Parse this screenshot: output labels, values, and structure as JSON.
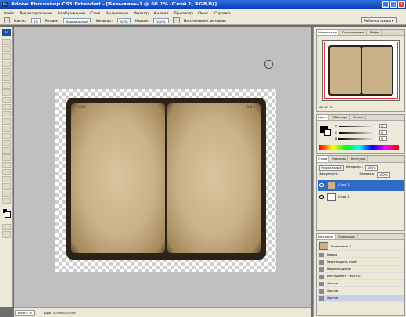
{
  "app": {
    "title": "Adobe Photoshop CS3 Extended - [Безымянн-1 @ 66.7% (Слой 2, RGB/8)]",
    "icon_label": "Ps"
  },
  "window_buttons": {
    "minimize": "_",
    "maximize": "□",
    "close": "×"
  },
  "menu": [
    "Файл",
    "Редактирование",
    "Изображение",
    "Слой",
    "Выделение",
    "Фильтр",
    "Анализ",
    "Просмотр",
    "Окно",
    "Справка"
  ],
  "options": {
    "brush_label": "Кисть:",
    "brush_size": "13",
    "mode_label": "Режим:",
    "mode_value": "Нормальный",
    "opacity_label": "Непрозр.:",
    "opacity_value": "67%",
    "flow_label": "Нажим:",
    "flow_value": "100%",
    "history_checkbox": "Восстановить историю",
    "workspace": "Рабочая среда ▾"
  },
  "document": {
    "page_num_left": "183",
    "page_num_right": "184"
  },
  "status": {
    "zoom": "66.67 %",
    "doc_info": "Док: 3,09M/2,07M"
  },
  "navigator": {
    "tabs": [
      "Навигатор",
      "Гистограмма",
      "Инфо"
    ],
    "zoom": "66.67 %"
  },
  "color_panel": {
    "tabs": [
      "Цвет",
      "Образцы",
      "Стили"
    ],
    "channels": [
      {
        "label": "R",
        "value": "0"
      },
      {
        "label": "G",
        "value": "0"
      },
      {
        "label": "B",
        "value": "0"
      }
    ]
  },
  "layers_panel": {
    "tabs": [
      "Слои",
      "Каналы",
      "Контуры"
    ],
    "blend_mode": "Нормальный",
    "opacity_label": "Непрозр.:",
    "opacity_value": "100%",
    "lock_label": "Закрепить:",
    "fill_label": "Заливка:",
    "fill_value": "100%",
    "layers": [
      {
        "name": "Слой 2",
        "selected": true
      },
      {
        "name": "Слой 1",
        "selected": false
      }
    ]
  },
  "history_panel": {
    "tabs": [
      "История",
      "Операции"
    ],
    "snapshot": "Безымянн-1",
    "items": [
      "Новый",
      "Перетащить слой",
      "Перемещение",
      "Инструмент \"Кисть\"",
      "Ластик",
      "Ластик",
      "Ластик"
    ]
  },
  "colors": {
    "accent": "#316ac5",
    "title": "#0a3fb8",
    "paper": "#c9b287"
  }
}
